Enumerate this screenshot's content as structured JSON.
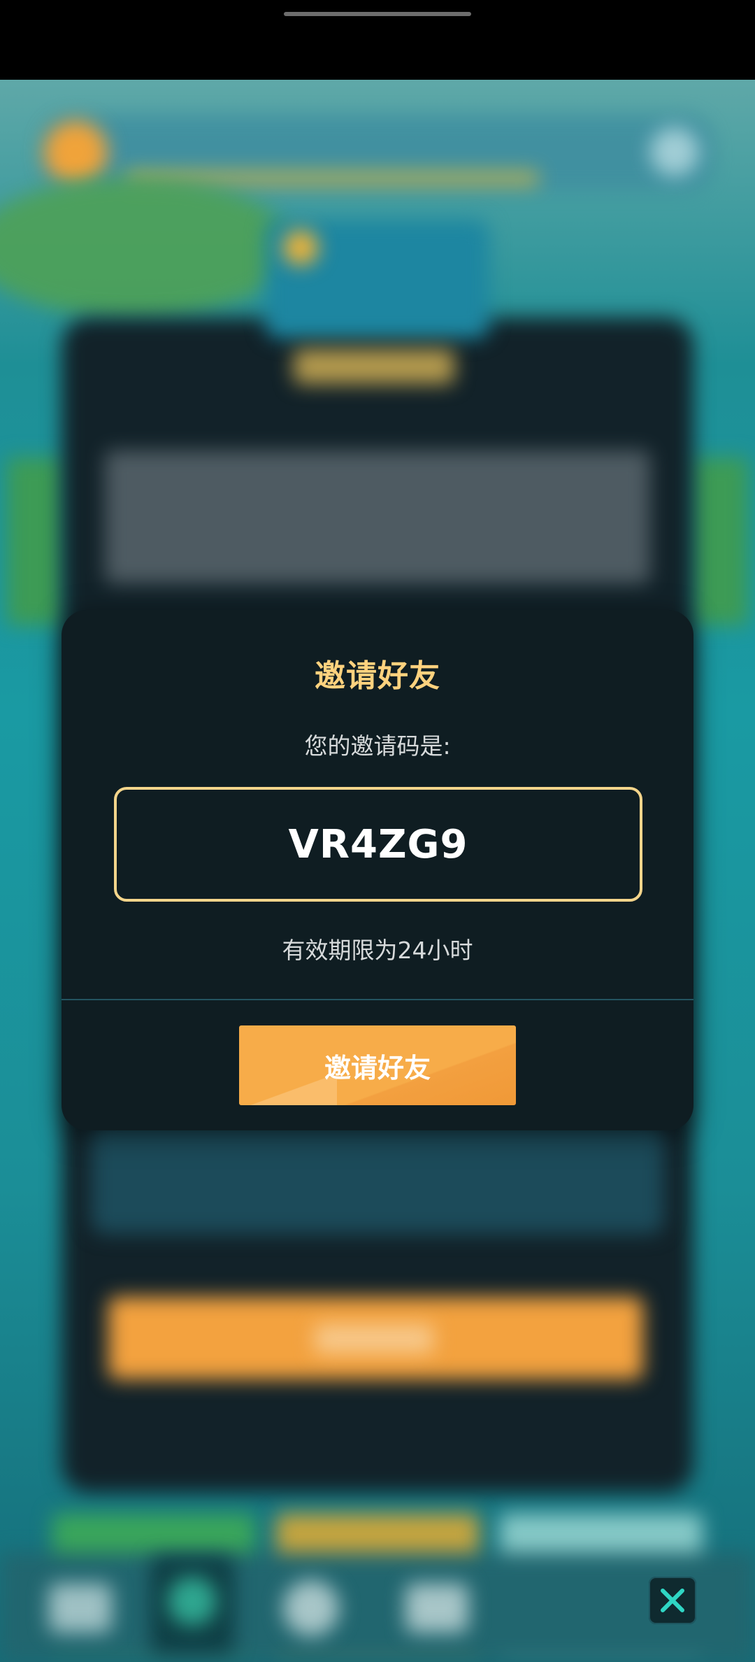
{
  "dialog": {
    "title": "邀请好友",
    "code_label": "您的邀请码是:",
    "invite_code": "VR4ZG9",
    "validity": "有效期限为24小时",
    "invite_button_label": "邀请好友"
  },
  "icons": {
    "close": "close-icon"
  },
  "colors": {
    "dialog_bg": "#0f1d22",
    "title": "#ffd27e",
    "code_border": "#f4d58b",
    "button": "#f7ac49",
    "close_x": "#2fd6c4"
  }
}
